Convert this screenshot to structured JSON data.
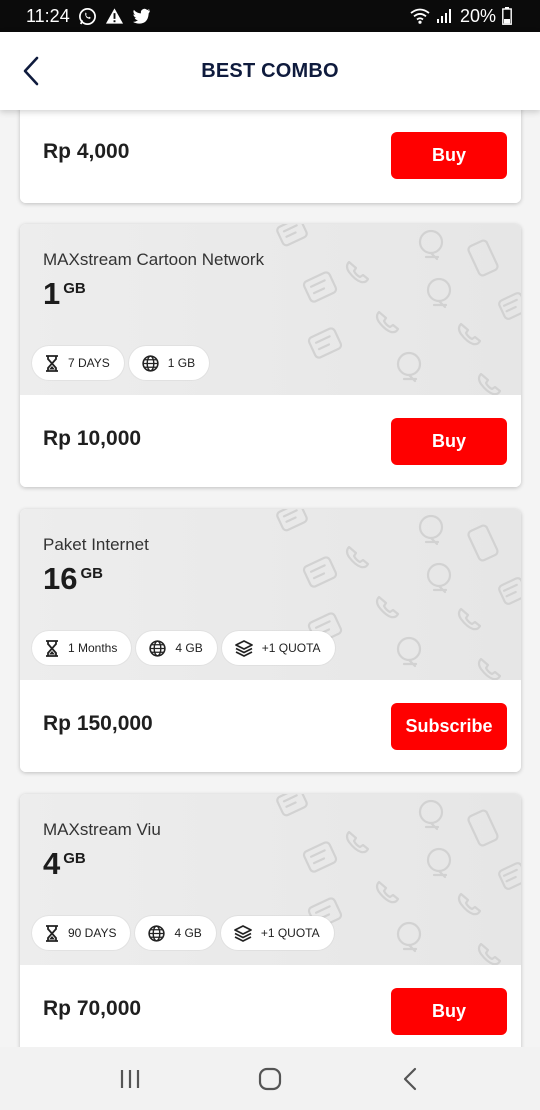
{
  "status_bar": {
    "time": "11:24",
    "battery": "20%",
    "left_icons": [
      "whatsapp-icon",
      "alert-icon",
      "twitter-icon"
    ],
    "right_icons": [
      "wifi-icon",
      "signal-icon",
      "battery-icon"
    ]
  },
  "header": {
    "title": "BEST COMBO",
    "back_icon": "chevron-left-icon"
  },
  "cards": [
    {
      "price": "Rp 4,000",
      "button": "Buy"
    },
    {
      "name": "MAXstream Cartoon Network",
      "size": "1",
      "unit": "GB",
      "chips": [
        {
          "icon": "hourglass-icon",
          "label": "7 DAYS"
        },
        {
          "icon": "globe-icon",
          "label": "1 GB"
        }
      ],
      "price": "Rp 10,000",
      "button": "Buy"
    },
    {
      "name": "Paket Internet",
      "size": "16",
      "unit": "GB",
      "chips": [
        {
          "icon": "hourglass-icon",
          "label": "1 Months"
        },
        {
          "icon": "globe-icon",
          "label": "4 GB"
        },
        {
          "icon": "layers-icon",
          "label": "+1 QUOTA"
        }
      ],
      "price": "Rp 150,000",
      "button": "Subscribe"
    },
    {
      "name": "MAXstream Viu",
      "size": "4",
      "unit": "GB",
      "chips": [
        {
          "icon": "hourglass-icon",
          "label": "90 DAYS"
        },
        {
          "icon": "globe-icon",
          "label": "4 GB"
        },
        {
          "icon": "layers-icon",
          "label": "+1 QUOTA"
        }
      ],
      "price": "Rp 70,000",
      "button": "Buy"
    }
  ],
  "nav_bar": {
    "buttons": [
      "recents-icon",
      "home-icon",
      "back-icon"
    ]
  },
  "colors": {
    "accent": "#ff0000",
    "title": "#0f1b3d",
    "card_top": "#e9e9e9",
    "status_bar": "#0b0b0b"
  }
}
